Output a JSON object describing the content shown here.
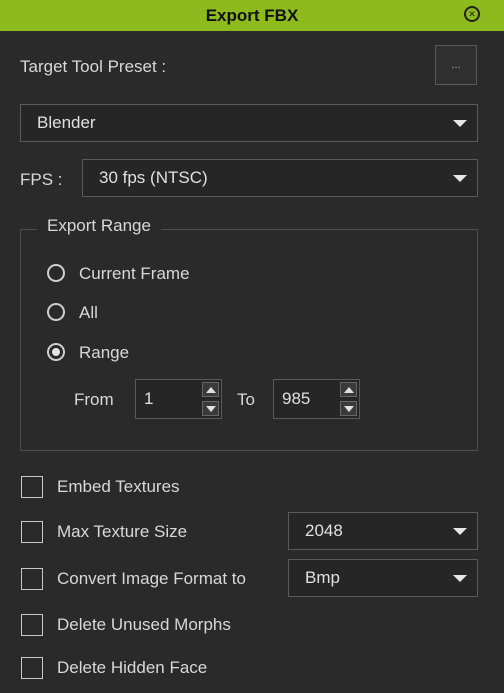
{
  "window": {
    "title": "Export FBX"
  },
  "preset": {
    "label": "Target Tool Preset :",
    "browse_label": "...",
    "selected": "Blender"
  },
  "fps": {
    "label": "FPS :",
    "selected": "30 fps (NTSC)"
  },
  "export_range": {
    "title": "Export Range",
    "options": [
      {
        "label": "Current Frame",
        "checked": false
      },
      {
        "label": "All",
        "checked": false
      },
      {
        "label": "Range",
        "checked": true
      }
    ],
    "from_label": "From",
    "from_value": "1",
    "to_label": "To",
    "to_value": "985"
  },
  "options": {
    "embed_textures": {
      "label": "Embed Textures",
      "checked": false
    },
    "max_texture_size": {
      "label": "Max Texture Size",
      "checked": false,
      "value": "2048"
    },
    "convert_image_format": {
      "label": "Convert Image Format to",
      "checked": false,
      "value": "Bmp"
    },
    "delete_unused_morphs": {
      "label": "Delete Unused Morphs",
      "checked": false
    },
    "delete_hidden_face": {
      "label": "Delete Hidden Face",
      "checked": false
    }
  },
  "colors": {
    "title_bar": "#8dba1d",
    "background": "#2a2a2a"
  }
}
